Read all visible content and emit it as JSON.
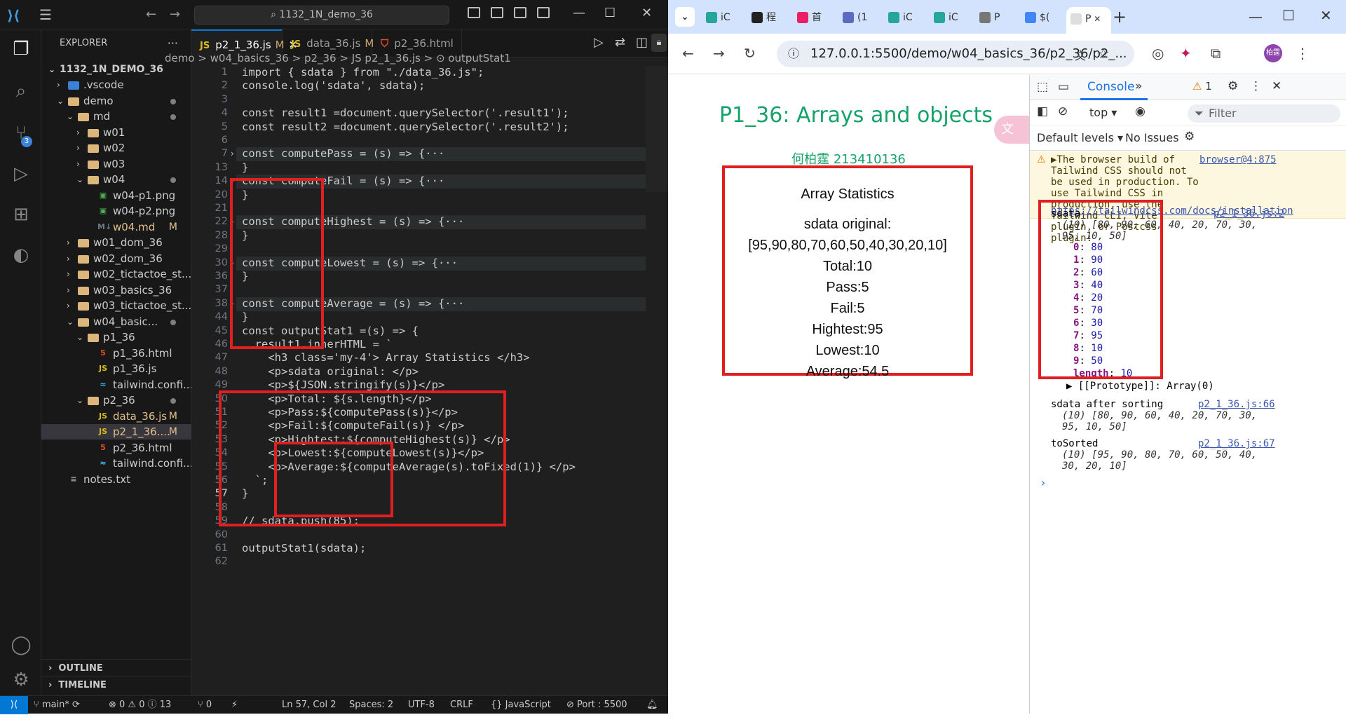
{
  "vscode": {
    "search_text": "1132_1N_demo_36",
    "explorer_title": "EXPLORER",
    "root": "1132_1N_DEMO_36",
    "tree": [
      {
        "label": ".vscode",
        "depth": 1,
        "type": "folder-closed"
      },
      {
        "label": "demo",
        "depth": 1,
        "type": "folder-open",
        "dot": true
      },
      {
        "label": "md",
        "depth": 2,
        "type": "folder-open",
        "dot": true
      },
      {
        "label": "w01",
        "depth": 3,
        "type": "folder-closed"
      },
      {
        "label": "w02",
        "depth": 3,
        "type": "folder-closed"
      },
      {
        "label": "w03",
        "depth": 3,
        "type": "folder-closed"
      },
      {
        "label": "w04",
        "depth": 3,
        "type": "folder-open",
        "dot": true
      },
      {
        "label": "w04-p1.png",
        "depth": 4,
        "type": "image"
      },
      {
        "label": "w04-p2.png",
        "depth": 4,
        "type": "image"
      },
      {
        "label": "w04.md",
        "depth": 4,
        "type": "md",
        "status": "M"
      },
      {
        "label": "w01_dom_36",
        "depth": 2,
        "type": "folder-closed"
      },
      {
        "label": "w02_dom_36",
        "depth": 2,
        "type": "folder-closed"
      },
      {
        "label": "w02_tictactoe_st...",
        "depth": 2,
        "type": "folder-closed"
      },
      {
        "label": "w03_basics_36",
        "depth": 2,
        "type": "folder-closed"
      },
      {
        "label": "w03_tictactoe_st...",
        "depth": 2,
        "type": "folder-closed"
      },
      {
        "label": "w04_basic...",
        "depth": 2,
        "type": "folder-open",
        "dot": true
      },
      {
        "label": "p1_36",
        "depth": 3,
        "type": "folder-open"
      },
      {
        "label": "p1_36.html",
        "depth": 4,
        "type": "html"
      },
      {
        "label": "p1_36.js",
        "depth": 4,
        "type": "js"
      },
      {
        "label": "tailwind.confi...",
        "depth": 4,
        "type": "config"
      },
      {
        "label": "p2_36",
        "depth": 3,
        "type": "folder-open",
        "dot": true
      },
      {
        "label": "data_36.js",
        "depth": 4,
        "type": "js",
        "status": "M"
      },
      {
        "label": "p2_1_36....",
        "depth": 4,
        "type": "js",
        "status": "M",
        "selected": true
      },
      {
        "label": "p2_36.html",
        "depth": 4,
        "type": "html"
      },
      {
        "label": "tailwind.confi...",
        "depth": 4,
        "type": "config"
      },
      {
        "label": "notes.txt",
        "depth": 1,
        "type": "txt"
      }
    ],
    "outline": "OUTLINE",
    "timeline": "TIMELINE",
    "tabs": [
      {
        "label": "p2_1_36.js",
        "status": "M",
        "type": "js",
        "active": true
      },
      {
        "label": "data_36.js",
        "status": "M",
        "type": "js"
      },
      {
        "label": "p2_36.html",
        "status": "",
        "type": "html"
      }
    ],
    "breadcrumb": "demo  >  w04_basics_36  >  p2_36  >  JS p2_1_36.js  >  ⊙ outputStat1",
    "lines": [
      {
        "n": "1",
        "t": "import { sdata } from \"./data_36.js\";"
      },
      {
        "n": "2",
        "t": "console.log('sdata', sdata);"
      },
      {
        "n": "3",
        "t": ""
      },
      {
        "n": "4",
        "t": "const result1 =document.querySelector('.result1');"
      },
      {
        "n": "5",
        "t": "const result2 =document.querySelector('.result2');"
      },
      {
        "n": "6",
        "t": ""
      },
      {
        "n": "7",
        "t": "const computePass = (s) => {···",
        "fold": true
      },
      {
        "n": "13",
        "t": "}"
      },
      {
        "n": "14",
        "t": "const computeFail = (s) => {···",
        "fold": true
      },
      {
        "n": "20",
        "t": "}"
      },
      {
        "n": "21",
        "t": ""
      },
      {
        "n": "22",
        "t": "const computeHighest = (s) => {···",
        "fold": true
      },
      {
        "n": "28",
        "t": "}"
      },
      {
        "n": "29",
        "t": ""
      },
      {
        "n": "30",
        "t": "const computeLowest = (s) => {···",
        "fold": true
      },
      {
        "n": "36",
        "t": "}"
      },
      {
        "n": "37",
        "t": ""
      },
      {
        "n": "38",
        "t": "const computeAverage = (s) => {···",
        "fold": true
      },
      {
        "n": "44",
        "t": "}"
      },
      {
        "n": "45",
        "t": "const outputStat1 =(s) => {"
      },
      {
        "n": "46",
        "t": "  result1.innerHTML = `"
      },
      {
        "n": "47",
        "t": "    <h3 class='my-4'> Array Statistics </h3>"
      },
      {
        "n": "48",
        "t": "    <p>sdata original: </p>"
      },
      {
        "n": "49",
        "t": "    <p>${JSON.stringify(s)}</p>"
      },
      {
        "n": "50",
        "t": "    <p>Total: ${s.length}</p>"
      },
      {
        "n": "51",
        "t": "    <p>Pass:${computePass(s)}</p>"
      },
      {
        "n": "52",
        "t": "    <p>Fail:${computeFail(s)} </p>"
      },
      {
        "n": "53",
        "t": "    <p>Hightest:${computeHighest(s)} </p>"
      },
      {
        "n": "54",
        "t": "    <p>Lowest:${computeLowest(s)}</p>"
      },
      {
        "n": "55",
        "t": "    <p>Average:${computeAverage(s).toFixed(1)} </p>"
      },
      {
        "n": "56",
        "t": "  `;"
      },
      {
        "n": "57",
        "t": "}"
      },
      {
        "n": "58",
        "t": ""
      },
      {
        "n": "59",
        "t": "// sdata.push(85);"
      },
      {
        "n": "60",
        "t": ""
      },
      {
        "n": "61",
        "t": "outputStat1(sdata);"
      },
      {
        "n": "62",
        "t": ""
      }
    ],
    "status": {
      "branch": "main*",
      "problems": "⊗ 0 ⚠ 0 ⓘ 13",
      "ports": "⑂ 0",
      "cursor": "Ln 57, Col 2",
      "spaces": "Spaces: 2",
      "encoding": "UTF-8",
      "eol": "CRLF",
      "language": "{} JavaScript",
      "port": "⊘ Port : 5500"
    }
  },
  "chrome": {
    "tabs": [
      "iC",
      "程",
      "首",
      "(1",
      "iC",
      "iC",
      "P",
      "$(",
      "P"
    ],
    "url": "127.0.0.1:5500/demo/w04_basics_36/p2_36/p2_...",
    "profile": "柏霆",
    "page": {
      "title": "P1_36: Arrays and objects",
      "author": "何柏霆 213410136",
      "heading": "Array Statistics",
      "original_label": "sdata original:",
      "original_values": "[95,90,80,70,60,50,40,30,20,10]",
      "total": "Total:10",
      "pass": "Pass:5",
      "fail": "Fail:5",
      "highest": "Hightest:95",
      "lowest": "Lowest:10",
      "average": "Average:54.5"
    },
    "devtools": {
      "console_tab": "Console",
      "warn_count": "1",
      "context": "top",
      "filter": "Filter",
      "levels": "Default levels",
      "issues": "No Issues",
      "warning_text": "▶The browser build of Tailwind CSS should not be used in production. To use Tailwind CSS in production, use the Tailwind CLI, Vite plugin, or Postcss plugin:",
      "warning_link": "https://tailwindcss.com/docs/installation",
      "warning_src": "browser@4:875",
      "log1_label": "sdata",
      "log1_src": "p2_1_36.js:2",
      "log1_summary": "(10) [80, 90, 60, 40, 20, 70, 30, 95, 10, 50]",
      "entries": [
        {
          "k": "0",
          "v": "80"
        },
        {
          "k": "1",
          "v": "90"
        },
        {
          "k": "2",
          "v": "60"
        },
        {
          "k": "3",
          "v": "40"
        },
        {
          "k": "4",
          "v": "20"
        },
        {
          "k": "5",
          "v": "70"
        },
        {
          "k": "6",
          "v": "30"
        },
        {
          "k": "7",
          "v": "95"
        },
        {
          "k": "8",
          "v": "10"
        },
        {
          "k": "9",
          "v": "50"
        }
      ],
      "length_label": "length",
      "length_value": "10",
      "prototype": "▶ [[Prototype]]: Array(0)",
      "log2_label": "sdata after sorting",
      "log2_src": "p2_1_36.js:66",
      "log2_summary": "(10) [80, 90, 60, 40, 20, 70, 30, 95, 10, 50]",
      "log3_label": "toSorted",
      "log3_src": "p2_1_36.js:67",
      "log3_summary": "(10) [95, 90, 80, 70, 60, 50, 40, 30, 20, 10]"
    }
  }
}
